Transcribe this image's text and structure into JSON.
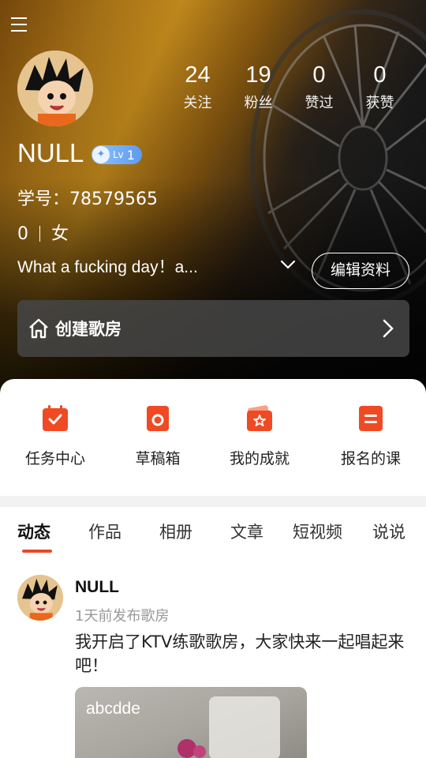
{
  "profile": {
    "nickname": "NULL",
    "level": {
      "prefix": "Lv",
      "value": "1"
    },
    "student_id": "学号：78579565",
    "age": "0",
    "gender": "女",
    "bio": "What a fucking day！a...",
    "edit_label": "编辑资料"
  },
  "stats": [
    {
      "num": "24",
      "label": "关注"
    },
    {
      "num": "19",
      "label": "粉丝"
    },
    {
      "num": "0",
      "label": "赞过"
    },
    {
      "num": "0",
      "label": "获赞"
    }
  ],
  "create_room": {
    "label": "创建歌房"
  },
  "shortcuts": [
    {
      "label": "任务中心",
      "icon": "calendar-check-icon"
    },
    {
      "label": "草稿箱",
      "icon": "draft-icon"
    },
    {
      "label": "我的成就",
      "icon": "achievement-icon"
    },
    {
      "label": "报名的课",
      "icon": "course-icon"
    }
  ],
  "tabs": [
    {
      "label": "动态",
      "active": true
    },
    {
      "label": "作品"
    },
    {
      "label": "相册"
    },
    {
      "label": "文章"
    },
    {
      "label": "短视频"
    },
    {
      "label": "说说"
    }
  ],
  "post": {
    "author": "NULL",
    "time": "1天前发布歌房",
    "text": "我开启了KTV练歌歌房，大家快来一起唱起来吧！",
    "media_title": "abcdde"
  },
  "colors": {
    "accent": "#e84a2a",
    "shortcut_icon": "#f04a24"
  }
}
